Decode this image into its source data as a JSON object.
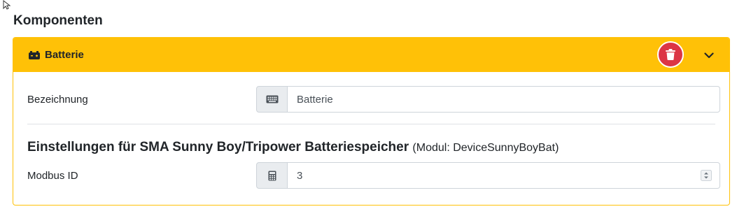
{
  "section": {
    "title": "Komponenten"
  },
  "component": {
    "title": "Batterie",
    "header_color": "#ffc107",
    "delete_color": "#dc3545",
    "icons": {
      "header": "battery-icon",
      "delete": "trash-icon",
      "collapse": "chevron-down-icon"
    }
  },
  "fields": {
    "name": {
      "label": "Bezeichnung",
      "value": "Batterie",
      "icon": "keyboard-icon"
    },
    "modbus": {
      "label": "Modbus ID",
      "value": "3",
      "icon": "calculator-icon"
    }
  },
  "settings": {
    "heading": "Einstellungen für SMA Sunny Boy/Tripower Batteriespeicher",
    "module": "(Modul: DeviceSunnyBoyBat)"
  }
}
